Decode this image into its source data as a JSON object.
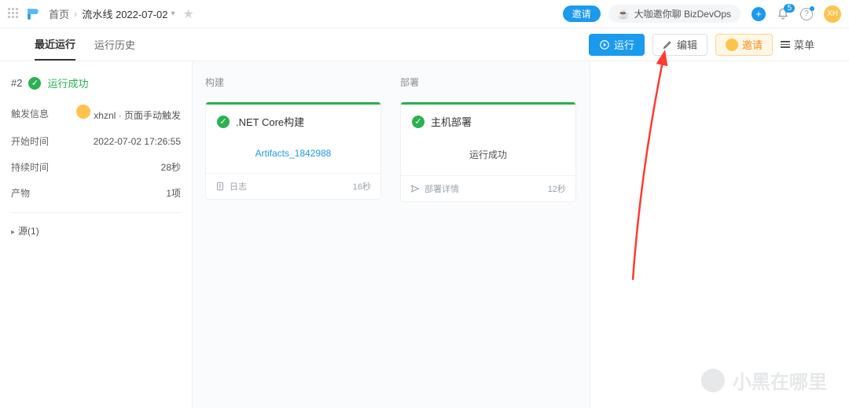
{
  "header": {
    "home": "首页",
    "pipeline": "流水线 2022-07-02",
    "invite": "邀请",
    "biz_text": "大咖邀你聊 BizDevOps",
    "bell_badge": "5",
    "avatar_text": "XH"
  },
  "toolbar": {
    "tabs": [
      "最近运行",
      "运行历史"
    ],
    "run": "运行",
    "edit": "编辑",
    "invite": "邀请",
    "menu": "菜单"
  },
  "run": {
    "number": "#2",
    "status": "运行成功",
    "trigger_label": "触发信息",
    "trigger_user": "xhznl",
    "trigger_mode": "页面手动触发",
    "start_label": "开始时间",
    "start_value": "2022-07-02 17:26:55",
    "duration_label": "持续时间",
    "duration_value": "28秒",
    "artifact_label": "产物",
    "artifact_value": "1项",
    "source_label": "源(1)"
  },
  "stages": {
    "build": {
      "title": "构建",
      "card_title": ".NET Core构建",
      "artifact": "Artifacts_1842988",
      "log_label": "日志",
      "duration": "16秒"
    },
    "deploy": {
      "title": "部署",
      "card_title": "主机部署",
      "result": "运行成功",
      "detail_label": "部署详情",
      "duration": "12秒"
    }
  },
  "watermark": "小黑在哪里"
}
